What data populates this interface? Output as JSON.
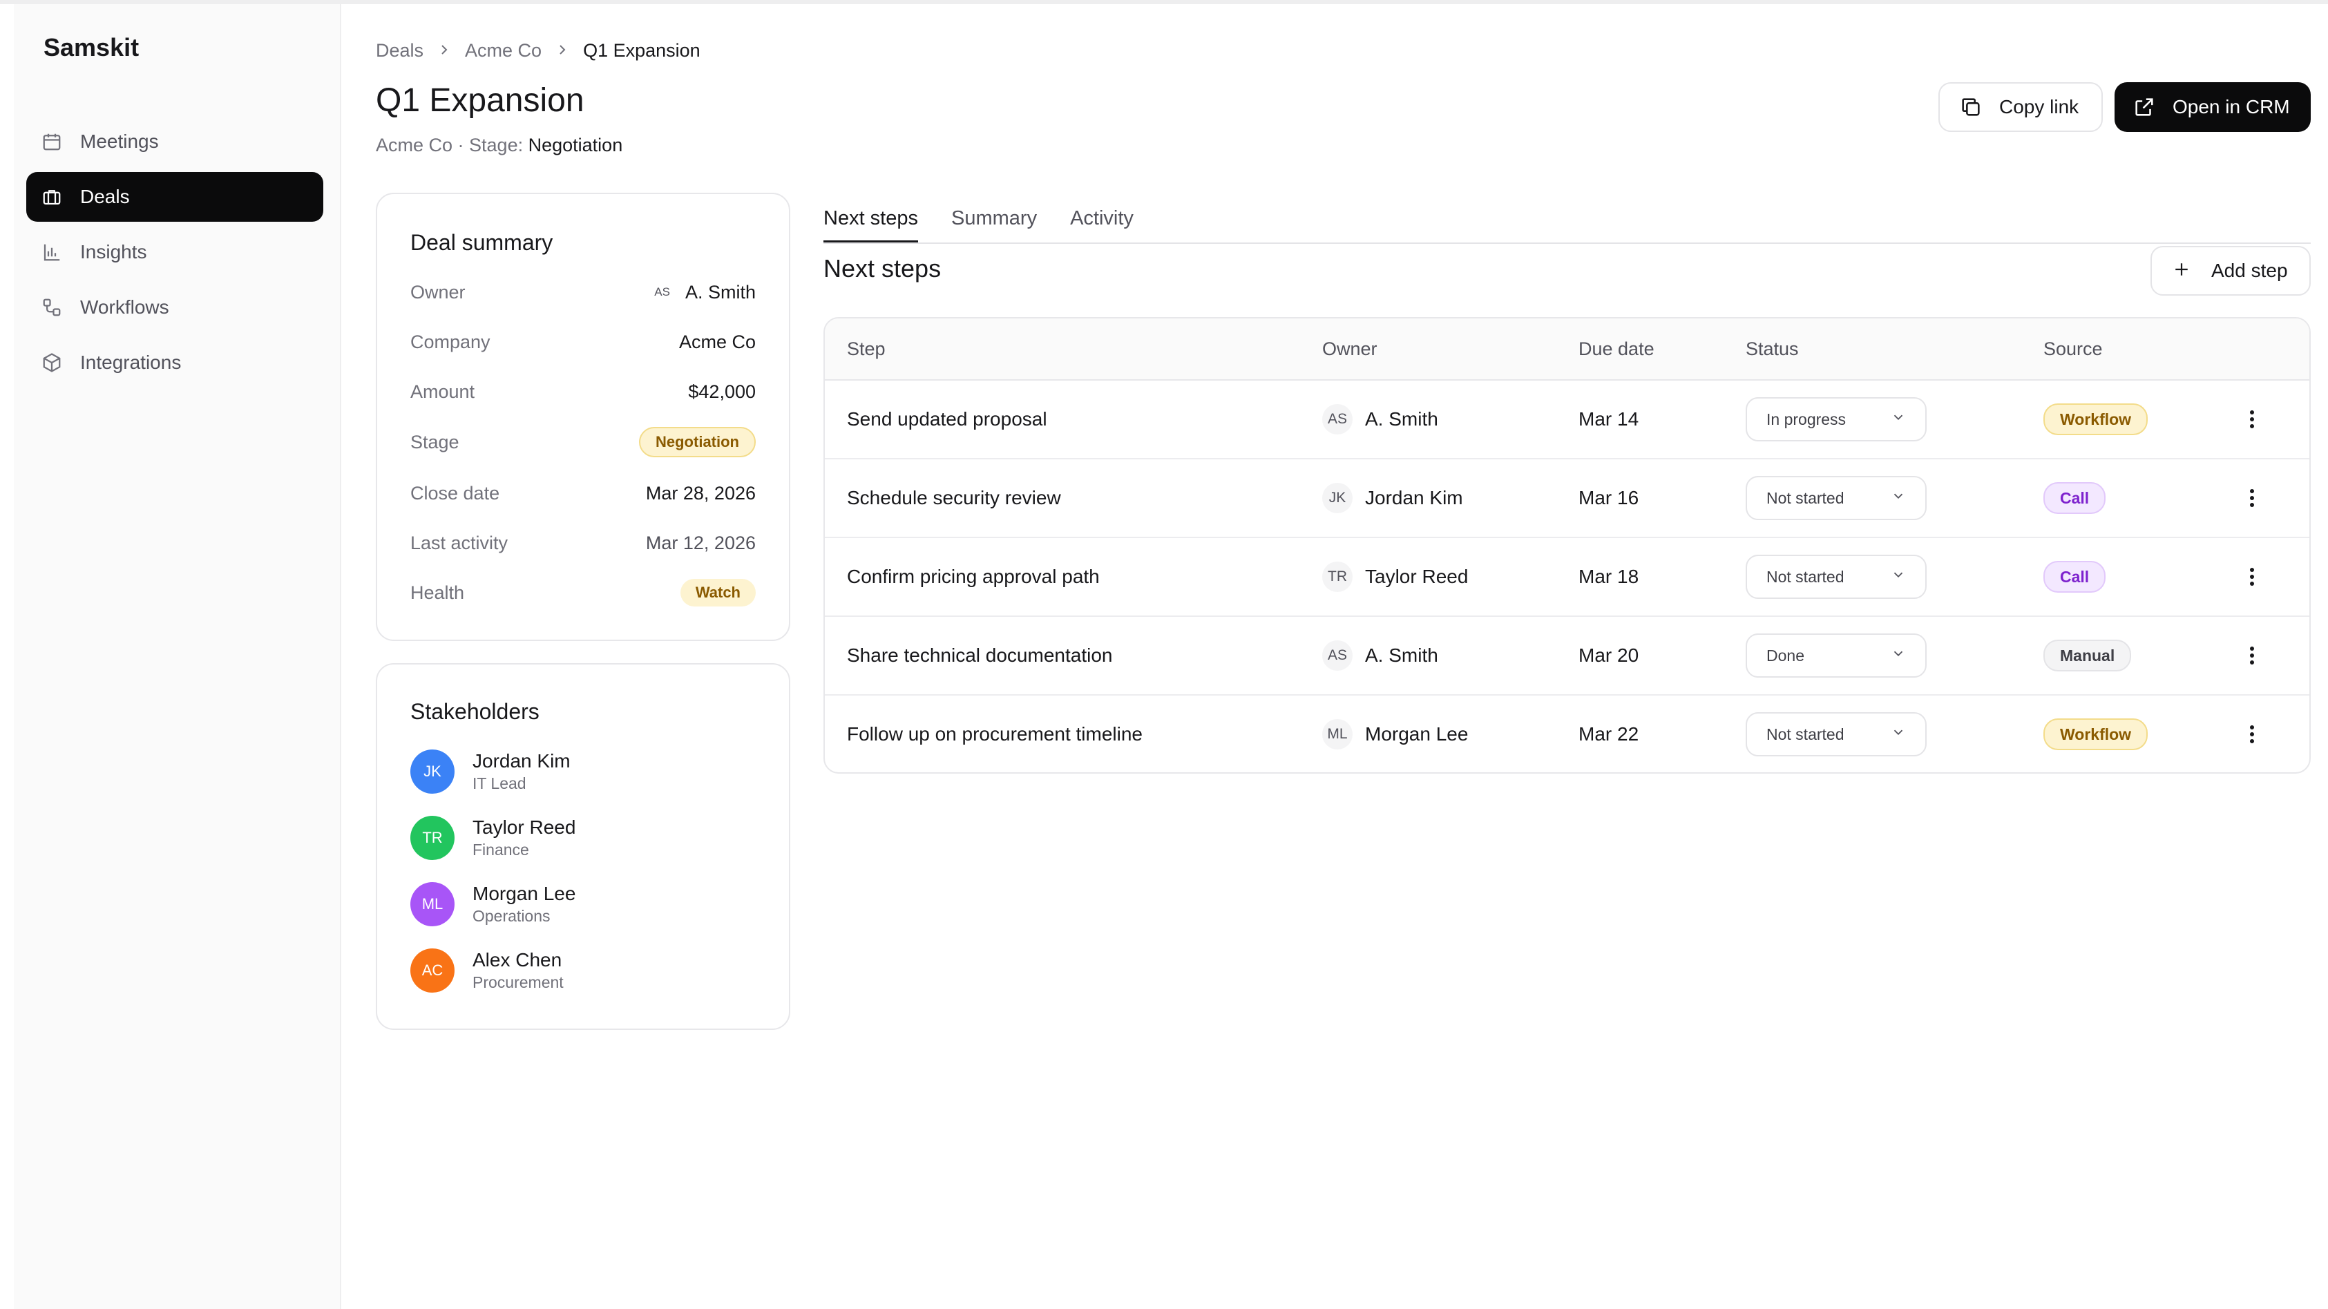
{
  "app": {
    "brand": "Samskit"
  },
  "sidebar": {
    "items": [
      {
        "label": "Meetings",
        "icon": "calendar-icon"
      },
      {
        "label": "Deals",
        "icon": "briefcase-icon",
        "active": true
      },
      {
        "label": "Insights",
        "icon": "bar-chart-icon"
      },
      {
        "label": "Workflows",
        "icon": "workflow-icon"
      },
      {
        "label": "Integrations",
        "icon": "cube-icon"
      }
    ]
  },
  "breadcrumb": [
    "Deals",
    "Acme Co",
    "Q1 Expansion"
  ],
  "header": {
    "title": "Q1 Expansion",
    "subtitle_prefix": "Acme Co · Stage:",
    "stage": "Negotiation",
    "copy_link": "Copy link",
    "open_crm": "Open in CRM"
  },
  "deal_summary": {
    "title": "Deal summary",
    "rows": [
      {
        "label": "Owner",
        "initials": "AS",
        "value": "A. Smith"
      },
      {
        "label": "Company",
        "value": "Acme Co"
      },
      {
        "label": "Amount",
        "value": "$42,000"
      },
      {
        "label": "Stage",
        "value": "Negotiation"
      },
      {
        "label": "Close date",
        "value": "Mar 28, 2026"
      },
      {
        "label": "Last activity",
        "value": "Mar 12, 2026"
      },
      {
        "label": "Health",
        "value": "Watch"
      }
    ]
  },
  "stakeholders": {
    "title": "Stakeholders",
    "people": [
      {
        "initials": "JK",
        "name": "Jordan Kim",
        "role": "IT Lead",
        "color": "#3b82f6"
      },
      {
        "initials": "TR",
        "name": "Taylor Reed",
        "role": "Finance",
        "color": "#22c55e"
      },
      {
        "initials": "ML",
        "name": "Morgan Lee",
        "role": "Operations",
        "color": "#a855f7"
      },
      {
        "initials": "AC",
        "name": "Alex Chen",
        "role": "Procurement",
        "color": "#f97316"
      }
    ]
  },
  "tabs": [
    "Next steps",
    "Summary",
    "Activity"
  ],
  "next_steps": {
    "title": "Next steps",
    "add_label": "Add step",
    "columns": [
      "Step",
      "Owner",
      "Due date",
      "Status",
      "Source"
    ],
    "rows": [
      {
        "step": "Send updated proposal",
        "owner_initials": "AS",
        "owner": "A. Smith",
        "due": "Mar 14",
        "status": "In progress",
        "source": "Workflow"
      },
      {
        "step": "Schedule security review",
        "owner_initials": "JK",
        "owner": "Jordan Kim",
        "due": "Mar 16",
        "status": "Not started",
        "source": "Call"
      },
      {
        "step": "Confirm pricing approval path",
        "owner_initials": "TR",
        "owner": "Taylor Reed",
        "due": "Mar 18",
        "status": "Not started",
        "source": "Call"
      },
      {
        "step": "Share technical documentation",
        "owner_initials": "AS",
        "owner": "A. Smith",
        "due": "Mar 20",
        "status": "Done",
        "source": "Manual"
      },
      {
        "step": "Follow up on procurement timeline",
        "owner_initials": "ML",
        "owner": "Morgan Lee",
        "due": "Mar 22",
        "status": "Not started",
        "source": "Workflow"
      }
    ]
  }
}
